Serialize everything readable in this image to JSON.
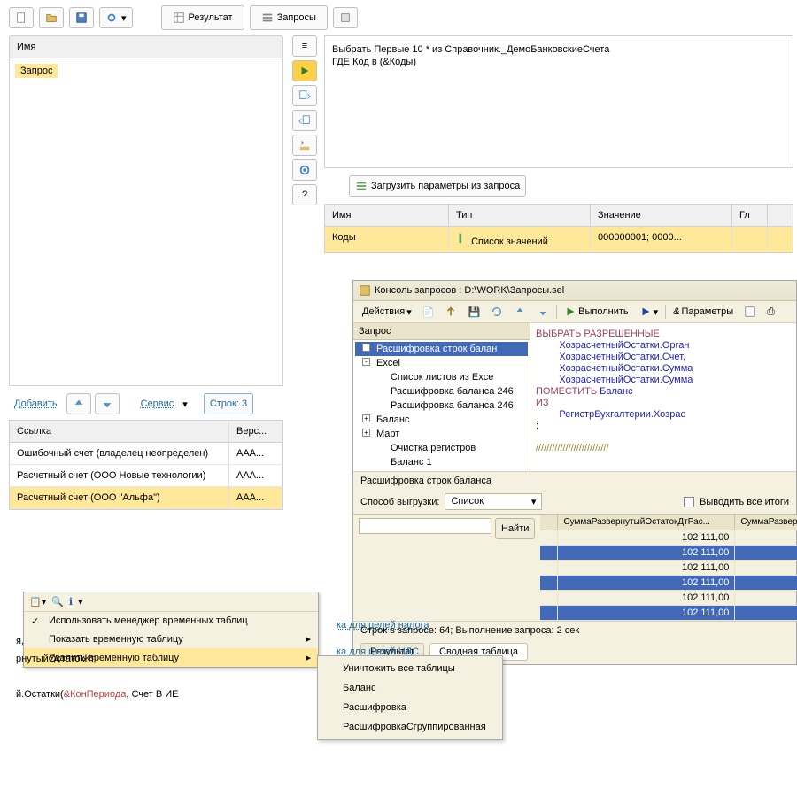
{
  "top": {
    "result": "Результат",
    "queries": "Запросы"
  },
  "left": {
    "header": "Имя",
    "tree_item": "Запрос",
    "add": "Добавить",
    "service": "Сервис",
    "rows_label": "Строк: 3",
    "table": {
      "col_ref": "Ссылка",
      "col_ver": "Верс...",
      "rows": [
        {
          "ref": "Ошибочный счет (владелец неопределен)",
          "ver": "ААА..."
        },
        {
          "ref": "Расчетный счет (ООО Новые технологии)",
          "ver": "ААА..."
        },
        {
          "ref": "Расчетный счет (ООО \"Альфа\")",
          "ver": "ААА..."
        }
      ]
    }
  },
  "editor": {
    "line1": "Выбрать Первые 10 * из Справочник._ДемоБанковскиеСчета",
    "line2": "ГДЕ Код в (&Коды)",
    "load_params": "Загрузить параметры из запроса",
    "params": {
      "cols": [
        "Имя",
        "Тип",
        "Значение",
        "Гл"
      ],
      "row": {
        "name": "Коды",
        "type": "Список значений",
        "value": "000000001; 0000..."
      }
    }
  },
  "console": {
    "title": "Консоль запросов : D:\\WORK\\Запросы.sel",
    "actions": "Действия",
    "execute": "Выполнить",
    "params": "Параметры",
    "tree_hdr": "Запрос",
    "tree": [
      {
        "t": "Расшифровка строк балан",
        "sel": true
      },
      {
        "t": "Excel",
        "exp": "-"
      },
      {
        "t": "Список листов из Exce",
        "ind": true
      },
      {
        "t": "Расшифровка баланса 246"
      },
      {
        "t": "Расшифровка баланса 246"
      },
      {
        "t": "Баланс",
        "exp": "+"
      },
      {
        "t": "Март",
        "exp": "+"
      },
      {
        "t": "Очистка регистров"
      },
      {
        "t": "Баланс 1"
      }
    ],
    "code": {
      "l1a": "ВЫБРАТЬ РАЗРЕШЕННЫЕ",
      "l2": "ХозрасчетныйОстатки.Орган",
      "l3": "ХозрасчетныйОстатки.Счет,",
      "l4": "ХозрасчетныйОстатки.Сумма",
      "l5": "ХозрасчетныйОстатки.Сумма",
      "l6a": "ПОМЕСТИТЬ",
      "l6b": " Баланс",
      "l7": "ИЗ",
      "l8": "РегистрБухгалтерии.Хозрас",
      "l9": ";",
      "l10": "///////////////////////////"
    },
    "mid_label": "Расшифровка строк баланса",
    "export_label": "Способ выгрузки:",
    "export_value": "Список",
    "show_totals": "Выводить все итоги",
    "find": "Найти",
    "grid_cols": [
      "СуммаРазвернутыйОстатокДтРас...",
      "СуммаРазвер"
    ],
    "grid_values": [
      "102 111,00",
      "102 111,00",
      "102 111,00",
      "102 111,00",
      "102 111,00",
      "102 111,00"
    ],
    "status": "Строк в запросе: 64; Выполнение запроса: 2 сек",
    "tab_result": "Результат",
    "tab_pivot": "Сводная таблица"
  },
  "links": {
    "tax": "ка для целей налога",
    "vat": "ка для целей НДС"
  },
  "ctx": {
    "use_temp_mgr": "Использовать менеджер временных таблиц",
    "show_temp": "Показать временную таблицу",
    "del_temp": "Удалить временную таблицу",
    "sub": [
      "Уничтожить все таблицы",
      "Баланс",
      "Расшифровка",
      "РасшифровкаСгруппированная"
    ]
  },
  "snip": {
    "p1a": "я,",
    "p1b": "рнутыйОстатокКт",
    "p2a": "й.Остатки(",
    "p2b": "&КонПериода",
    "p2c": ", Счет В ИЕ"
  }
}
